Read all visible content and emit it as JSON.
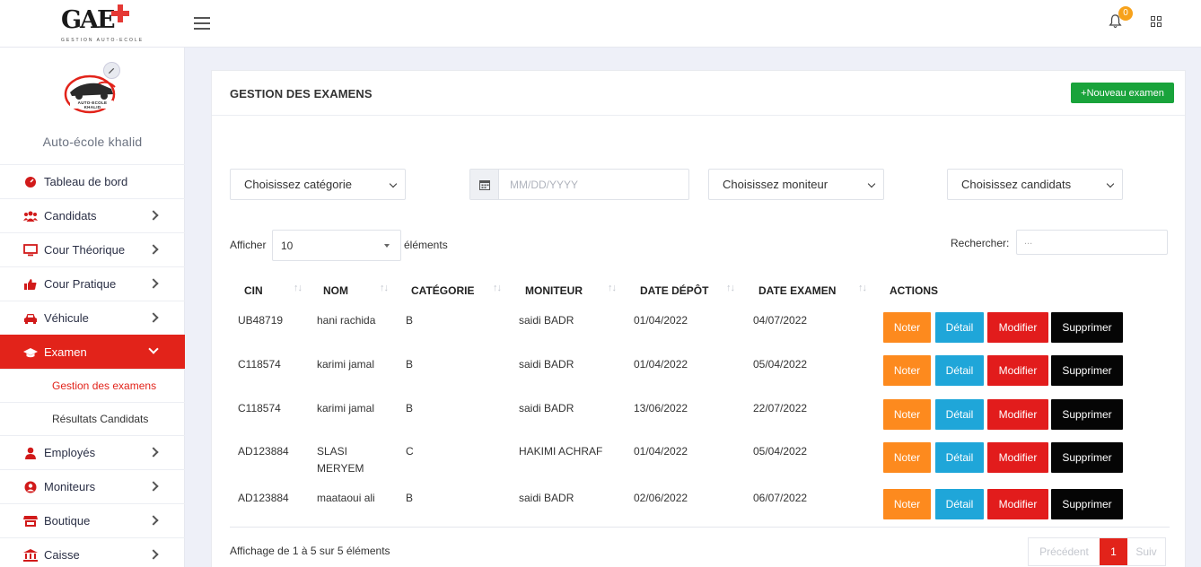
{
  "header": {
    "logo_text": "GAE",
    "logo_subtitle": "GESTION AUTO-ECOLE",
    "notification_count": "0"
  },
  "sidebar": {
    "school_name": "Auto-école khalid",
    "school_logo_text": "AUTO-ECOLE KHALID",
    "items": [
      {
        "label": "Tableau de bord",
        "icon": "dashboard-icon"
      },
      {
        "label": "Candidats",
        "icon": "users-icon"
      },
      {
        "label": "Cour Théorique",
        "icon": "monitor-icon"
      },
      {
        "label": "Cour Pratique",
        "icon": "thumbs-up-icon"
      },
      {
        "label": "Véhicule",
        "icon": "car-icon"
      },
      {
        "label": "Examen",
        "icon": "graduation-cap-icon"
      },
      {
        "label": "Employés",
        "icon": "user-icon"
      },
      {
        "label": "Moniteurs",
        "icon": "user-circle-icon"
      },
      {
        "label": "Boutique",
        "icon": "store-icon"
      },
      {
        "label": "Caisse",
        "icon": "bank-icon"
      }
    ],
    "subitems": [
      {
        "label": "Gestion des examens"
      },
      {
        "label": "Résultats Candidats"
      }
    ]
  },
  "main": {
    "title": "GESTION DES EXAMENS",
    "new_button": "+Nouveau examen",
    "filters": {
      "category": "Choisissez catégorie",
      "date_placeholder": "MM/DD/YYYY",
      "monitor": "Choisissez moniteur",
      "candidates": "Choisissez candidats"
    },
    "show_label": "Afficher",
    "page_length": "10",
    "elements_label": "éléments",
    "search_label": "Rechercher:",
    "search_placeholder": "...",
    "columns": [
      "CIN",
      "NOM",
      "CATÉGORIE",
      "MONITEUR",
      "DATE DÉPÔT",
      "DATE EXAMEN",
      "ACTIONS"
    ],
    "rows": [
      {
        "cin": "UB48719",
        "nom": "hani rachida",
        "nom2": "",
        "cat": "B",
        "moniteur": "saidi BADR",
        "depot": "01/04/2022",
        "examen": "04/07/2022"
      },
      {
        "cin": "C118574",
        "nom": "karimi jamal",
        "nom2": "",
        "cat": "B",
        "moniteur": "saidi BADR",
        "depot": "01/04/2022",
        "examen": "05/04/2022"
      },
      {
        "cin": "C118574",
        "nom": "karimi jamal",
        "nom2": "",
        "cat": "B",
        "moniteur": "saidi BADR",
        "depot": "13/06/2022",
        "examen": "22/07/2022"
      },
      {
        "cin": "AD123884",
        "nom": "SLASI",
        "nom2": "MERYEM",
        "cat": "C",
        "moniteur": "HAKIMI ACHRAF",
        "depot": "01/04/2022",
        "examen": "05/04/2022"
      },
      {
        "cin": "AD123884",
        "nom": "maataoui ali",
        "nom2": "",
        "cat": "B",
        "moniteur": "saidi BADR",
        "depot": "02/06/2022",
        "examen": "06/07/2022"
      }
    ],
    "actions": {
      "noter": "Noter",
      "detail": "Détail",
      "modifier": "Modifier",
      "supprimer": "Supprimer"
    },
    "info": "Affichage de 1 à 5 sur 5 éléments",
    "pagination": {
      "prev": "Précédent",
      "current": "1",
      "next": "Suiv"
    }
  },
  "colors": {
    "accent": "#e2231a",
    "green": "#19a33b",
    "orange": "#fd8a1e",
    "blue": "#1fa6d9",
    "black": "#050505"
  }
}
